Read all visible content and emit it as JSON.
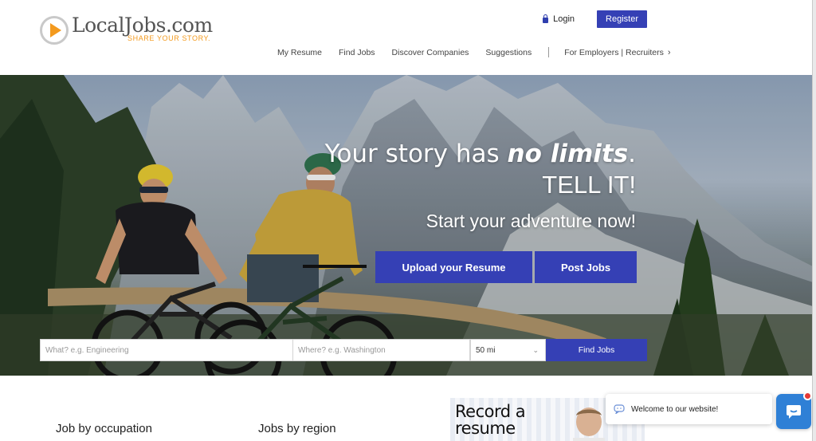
{
  "brand": {
    "name": "LocalJobs.com",
    "tagline": "SHARE YOUR STORY.",
    "accent": "#f39a1e",
    "primary": "#3540b5"
  },
  "header": {
    "login_label": "Login",
    "register_label": "Register",
    "nav": [
      "My Resume",
      "Find Jobs",
      "Discover Companies",
      "Suggestions"
    ],
    "employers_label": "For Employers | Recruiters"
  },
  "hero": {
    "headline_pre": "Your story has ",
    "headline_em": "no limits",
    "headline_post": ".",
    "headline2": "TELL IT!",
    "subheadline": "Start your adventure now!",
    "upload_label": "Upload your Resume",
    "post_label": "Post Jobs"
  },
  "search": {
    "what_placeholder": "What? e.g. Engineering",
    "where_placeholder": "Where? e.g. Washington",
    "distance_value": "50 mi",
    "submit_label": "Find Jobs"
  },
  "sections": {
    "occupation_title": "Job by occupation",
    "region_title": "Jobs by region",
    "promo_line1": "Record a",
    "promo_line2": "resume"
  },
  "chat": {
    "welcome_text": "Welcome to our website!"
  },
  "icons": [
    "play-logo-icon",
    "lock-icon",
    "chevron-right-icon",
    "chevron-down-icon",
    "chat-icon",
    "chat-bubble-icon"
  ]
}
